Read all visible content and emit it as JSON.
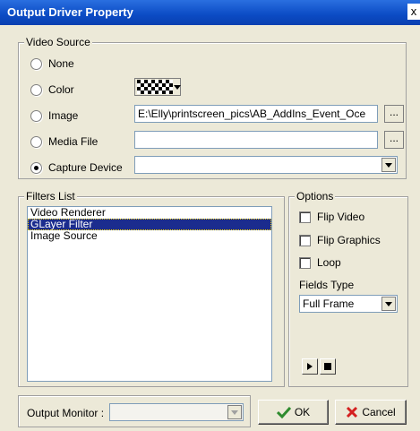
{
  "window": {
    "title": "Output Driver Property",
    "close_label": "x"
  },
  "video_source": {
    "legend": "Video Source",
    "none_label": "None",
    "color_label": "Color",
    "image_label": "Image",
    "media_file_label": "Media File",
    "capture_device_label": "Capture Device",
    "selected": "Capture Device",
    "image_path": "E:\\Elly\\printscreen_pics\\AB_AddIns_Event_Oce",
    "media_file_path": "",
    "capture_device_value": "",
    "browse_label": "..."
  },
  "filters": {
    "legend": "Filters List",
    "items": [
      "Video Renderer",
      " GLayer Filter",
      "Image Source"
    ],
    "selected_index": 1
  },
  "options": {
    "legend": "Options",
    "flip_video_label": "Flip Video",
    "flip_graphics_label": "Flip Graphics",
    "loop_label": "Loop",
    "fields_type_label": "Fields Type",
    "fields_type_value": "Full Frame"
  },
  "bottom": {
    "output_monitor_label": "Output Monitor :",
    "output_monitor_value": "",
    "ok_label": "OK",
    "cancel_label": "Cancel"
  },
  "colors": {
    "title_bar": "#0b4bc4",
    "dialog_bg": "#ece9d8",
    "selection": "#1b2c8e",
    "ok_check": "#2e8b2e",
    "cancel_x": "#d42020"
  }
}
